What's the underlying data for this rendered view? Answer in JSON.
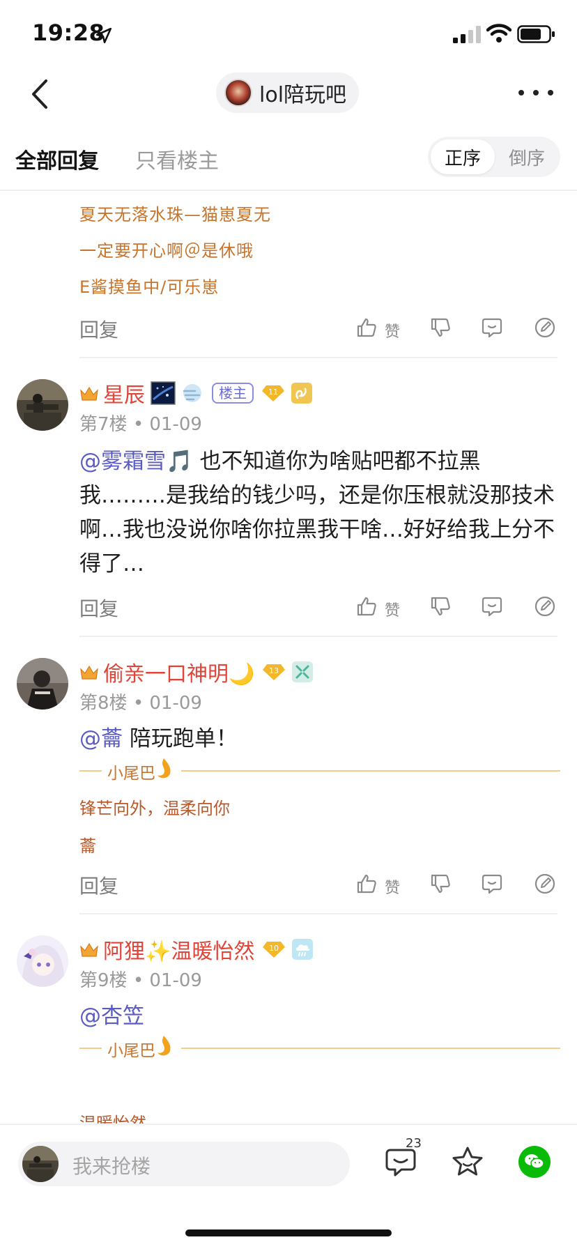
{
  "status_bar": {
    "time": "19:28"
  },
  "nav": {
    "forum_name": "lol陪玩吧"
  },
  "filter": {
    "tab_all": "全部回复",
    "tab_op": "只看楼主",
    "sort_asc": "正序",
    "sort_desc": "倒序"
  },
  "top_block": {
    "sig_lines": [
      "夏天无落水珠—猫崽夏无",
      "一定要开心啊＠是休哦",
      "E酱摸鱼中/可乐崽"
    ]
  },
  "actions": {
    "reply": "回复",
    "like": "赞"
  },
  "posts": [
    {
      "username": "星辰",
      "op_badge": "楼主",
      "level": "11",
      "floor": "第7楼",
      "date": "01-09",
      "mention": "@雾霜雪🎵",
      "text": " 也不知道你为啥贴吧都不拉黑我………是我给的钱少吗，还是你压根就没那技术啊…我也没说你啥你拉黑我干啥…好好给我上分不得了…"
    },
    {
      "username": "偷亲一口神明🌙",
      "level": "13",
      "floor": "第8楼",
      "date": "01-09",
      "mention": "@蘥",
      "text": " 陪玩跑单！",
      "tail_label": "小尾巴",
      "sig_lines": [
        "锋芒向外，温柔向你",
        "蘥"
      ]
    },
    {
      "username": "阿狸✨温暖怡然",
      "level": "10",
      "floor": "第9楼",
      "date": "01-09",
      "mention": "@杏笠",
      "tail_label": "小尾巴",
      "sig_lines": [
        "温暖怡然"
      ]
    }
  ],
  "bottom_bar": {
    "input_placeholder": "我来抢楼",
    "comment_count": "23"
  },
  "colors": {
    "username": "#e0453a",
    "mention": "#5b5bc5",
    "signature": "#c7742c",
    "wechat": "#09bb07"
  }
}
